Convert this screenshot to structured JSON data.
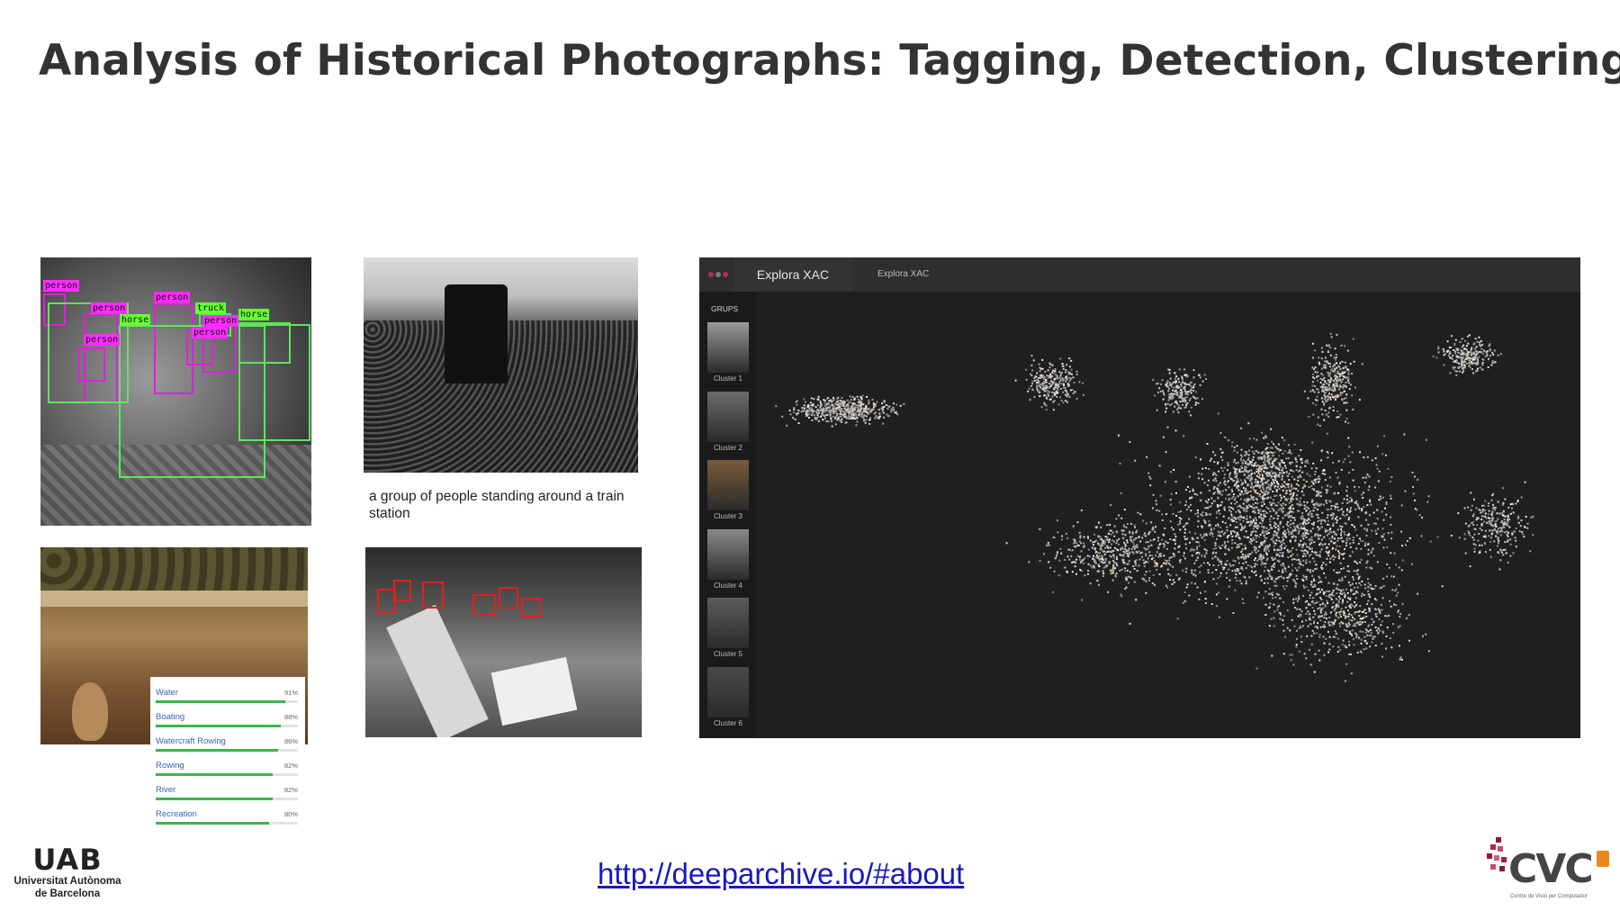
{
  "slide": {
    "title": "Analysis of Historical Photographs: Tagging, Detection, Clustering…",
    "link": "http://deeparchive.io/#about"
  },
  "detection": {
    "labels": [
      "person",
      "person",
      "person",
      "person",
      "person",
      "person",
      "truck",
      "horse",
      "horse"
    ]
  },
  "caption": {
    "text": "a group of people standing around a train station"
  },
  "tagging": {
    "tags": [
      {
        "name": "Water",
        "pct": "91%",
        "value": 0.91
      },
      {
        "name": "Boating",
        "pct": "88%",
        "value": 0.88
      },
      {
        "name": "Watercraft Rowing",
        "pct": "86%",
        "value": 0.86
      },
      {
        "name": "Rowing",
        "pct": "82%",
        "value": 0.82
      },
      {
        "name": "River",
        "pct": "82%",
        "value": 0.82
      },
      {
        "name": "Recreation",
        "pct": "80%",
        "value": 0.8
      }
    ],
    "bar_color": "#3cb54a"
  },
  "explora": {
    "tab_active": "Explora XAC",
    "tab_secondary": "Explora XAC",
    "groups_label": "GRUPS",
    "clusters": [
      "Cluster 1",
      "Cluster 2",
      "Cluster 3",
      "Cluster 4",
      "Cluster 5",
      "Cluster 6"
    ]
  },
  "logos": {
    "uab_mark": "UAB",
    "uab_name_1": "Universitat Autònoma",
    "uab_name_2": "de Barcelona",
    "cvc_mark": "CVC",
    "cvc_sub": "Centre de Visió per Computador"
  },
  "colors": {
    "title": "#333333",
    "link": "#1a1ab8",
    "person_box": "#e01ee0",
    "object_box": "#5ce65c",
    "face_box": "#e02020"
  }
}
